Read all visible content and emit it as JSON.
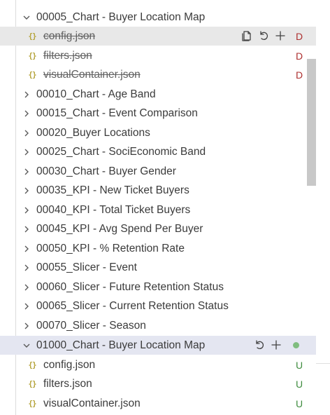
{
  "tree": {
    "group1": {
      "label": "00005_Chart - Buyer Location Map",
      "files": [
        {
          "name": "config.json",
          "status": "D"
        },
        {
          "name": "filters.json",
          "status": "D"
        },
        {
          "name": "visualContainer.json",
          "status": "D"
        }
      ]
    },
    "folders": [
      "00010_Chart - Age Band",
      "00015_Chart - Event Comparison",
      "00020_Buyer Locations",
      "00025_Chart - SociEconomic Band",
      "00030_Chart - Buyer Gender",
      "00035_KPI - New Ticket Buyers",
      "00040_KPI - Total Ticket Buyers",
      "00045_KPI - Avg Spend Per Buyer",
      "00050_KPI - % Retention Rate",
      "00055_Slicer - Event",
      "00060_Slicer - Future Retention Status",
      "00065_Slicer - Current Retention Status",
      "00070_Slicer - Season"
    ],
    "group2": {
      "label": "01000_Chart - Buyer Location Map",
      "files": [
        {
          "name": "config.json",
          "status": "U"
        },
        {
          "name": "filters.json",
          "status": "U"
        },
        {
          "name": "visualContainer.json",
          "status": "U"
        }
      ]
    }
  },
  "file_icon_glyph": "{}",
  "icons": [
    "chevron-down-icon",
    "chevron-right-icon",
    "json-file-icon",
    "open-file-icon",
    "discard-changes-icon",
    "stage-changes-icon",
    "modified-dot-icon"
  ],
  "colors": {
    "deleted": "#ad3030",
    "untracked": "#3f8c3f",
    "json_icon": "#b6a43c",
    "selection": "#e4e6f1",
    "hover": "#e8e8e8"
  }
}
